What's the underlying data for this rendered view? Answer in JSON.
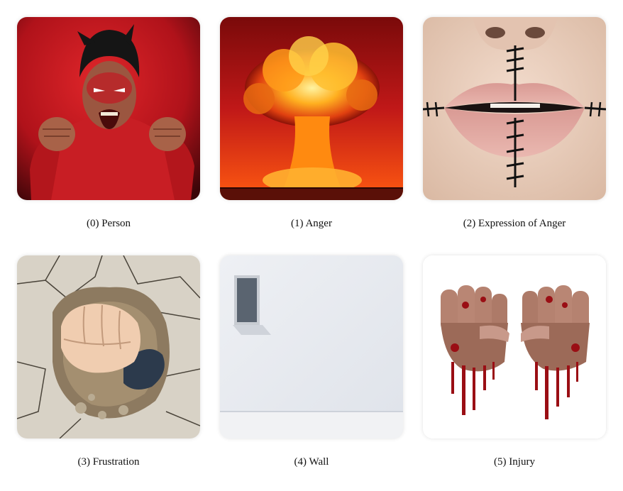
{
  "panels": [
    {
      "caption": "(0) Person",
      "subject": "angry-person"
    },
    {
      "caption": "(1) Anger",
      "subject": "explosion"
    },
    {
      "caption": "(2) Expression of Anger",
      "subject": "stitched-mouth"
    },
    {
      "caption": "(3) Frustration",
      "subject": "fist-through-wall"
    },
    {
      "caption": "(4) Wall",
      "subject": "white-wall"
    },
    {
      "caption": "(5) Injury",
      "subject": "bloody-fists"
    }
  ],
  "colors": {
    "red": "#c0141a",
    "fire": "#ff8a00",
    "wall": "#e8ebef"
  }
}
